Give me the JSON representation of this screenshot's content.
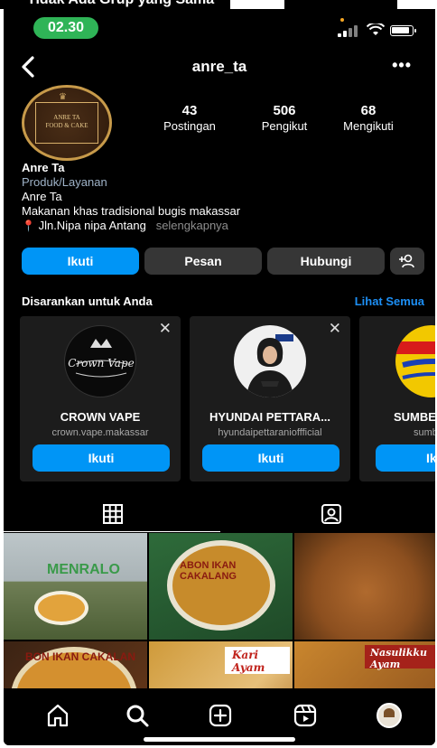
{
  "banner": {
    "text": "Tidak Ada Grup yang Sama"
  },
  "status_bar": {
    "time": "02.30",
    "battery_level": 0.8
  },
  "nav": {
    "username": "anre_ta",
    "back_icon": "chevron-left-icon",
    "more_icon": "more-horizontal-icon"
  },
  "profile": {
    "avatar_text": "ANRE TA\nFOOD & CAKE",
    "stats": [
      {
        "value": "43",
        "label": "Postingan"
      },
      {
        "value": "506",
        "label": "Pengikut"
      },
      {
        "value": "68",
        "label": "Mengikuti"
      }
    ],
    "name": "Anre Ta",
    "category": "Produk/Layanan",
    "line1": "Anre Ta",
    "line2": "Makanan khas tradisional bugis makassar",
    "location": "Jln.Nipa nipa Antang",
    "see_more": "selengkapnya"
  },
  "actions": {
    "follow": "Ikuti",
    "message": "Pesan",
    "contact": "Hubungi"
  },
  "suggestions": {
    "title": "Disarankan untuk Anda",
    "see_all": "Lihat Semua",
    "cards": [
      {
        "name": "CROWN VAPE",
        "handle": "crown.vape.makassar",
        "button": "Ikuti",
        "logo_text": "Crown Vape"
      },
      {
        "name": "HYUNDAI PETTARA...",
        "handle": "hyundaipettaranioffficial",
        "button": "Ikuti"
      },
      {
        "name": "SUMBE",
        "handle": "sumbe",
        "button": "Ik"
      }
    ]
  },
  "grid": {
    "tiles": [
      {
        "label": "MENRALO"
      },
      {
        "label": "ABON IKAN CAKALANG"
      },
      {
        "label": ""
      },
      {
        "label": "BON IKAN CAKALAN"
      },
      {
        "label": "Kari Ayam"
      },
      {
        "label": "Nasulikku Ayam"
      }
    ]
  },
  "colors": {
    "accent": "#0095f6",
    "background": "#000000",
    "button_dark": "#363636",
    "time_pill": "#2fb457"
  }
}
